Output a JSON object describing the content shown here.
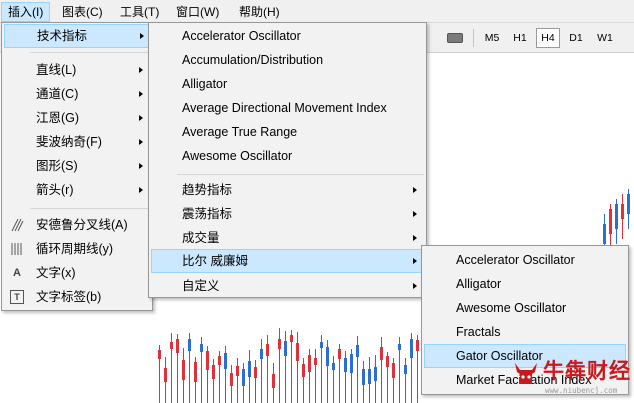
{
  "menubar": {
    "items": [
      {
        "label": "插入(I)",
        "active": true
      },
      {
        "label": "图表(C)",
        "active": false
      },
      {
        "label": "工具(T)",
        "active": false
      },
      {
        "label": "窗口(W)",
        "active": false
      },
      {
        "label": "帮助(H)",
        "active": false
      }
    ]
  },
  "toolbar": {
    "timeframes": [
      "M5",
      "H1",
      "H4",
      "D1",
      "W1"
    ],
    "selected_timeframe": "H4",
    "rect_icon": "rectangle-icon"
  },
  "insert_menu": {
    "items": [
      {
        "label": "技术指标",
        "submenu": true,
        "icon": ""
      },
      {
        "label": "直线(L)",
        "submenu": true,
        "icon": ""
      },
      {
        "label": "通道(C)",
        "submenu": true,
        "icon": ""
      },
      {
        "label": "江恩(G)",
        "submenu": true,
        "icon": ""
      },
      {
        "label": "斐波纳奇(F)",
        "submenu": true,
        "icon": ""
      },
      {
        "label": "图形(S)",
        "submenu": true,
        "icon": ""
      },
      {
        "label": "箭头(r)",
        "submenu": true,
        "icon": ""
      },
      {
        "label": "安德鲁分叉线(A)",
        "submenu": false,
        "icon": "andrews-pitchfork-icon"
      },
      {
        "label": "循环周期线(y)",
        "submenu": false,
        "icon": "cycle-lines-icon"
      },
      {
        "label": "文字(x)",
        "submenu": false,
        "icon": "text-icon"
      },
      {
        "label": "文字标签(b)",
        "submenu": false,
        "icon": "text-label-icon"
      }
    ],
    "icon_glyphs": {
      "text": "A",
      "text_label": "T"
    }
  },
  "indicators_menu": {
    "items": [
      {
        "label": "Accelerator Oscillator"
      },
      {
        "label": "Accumulation/Distribution"
      },
      {
        "label": "Alligator"
      },
      {
        "label": "Average Directional Movement Index"
      },
      {
        "label": "Average True Range"
      },
      {
        "label": "Awesome Oscillator"
      }
    ],
    "groups": [
      {
        "label": "趋势指标"
      },
      {
        "label": "震荡指标"
      },
      {
        "label": "成交量"
      },
      {
        "label": "比尔 威廉姆"
      },
      {
        "label": "自定义"
      }
    ]
  },
  "bill_williams_menu": {
    "items": [
      {
        "label": "Accelerator Oscillator"
      },
      {
        "label": "Alligator"
      },
      {
        "label": "Awesome Oscillator"
      },
      {
        "label": "Fractals"
      },
      {
        "label": "Gator Oscillator"
      },
      {
        "label": "Market Facilitation Index"
      }
    ]
  },
  "watermark": {
    "text": "牛犇财经",
    "url": "www.niubencĵ.com"
  },
  "colors": {
    "highlight": "#cce8ff",
    "highlight_border": "#99d1ff",
    "bull": "#2b6fd6",
    "bear": "#e0303a",
    "brand": "#c8191e"
  }
}
